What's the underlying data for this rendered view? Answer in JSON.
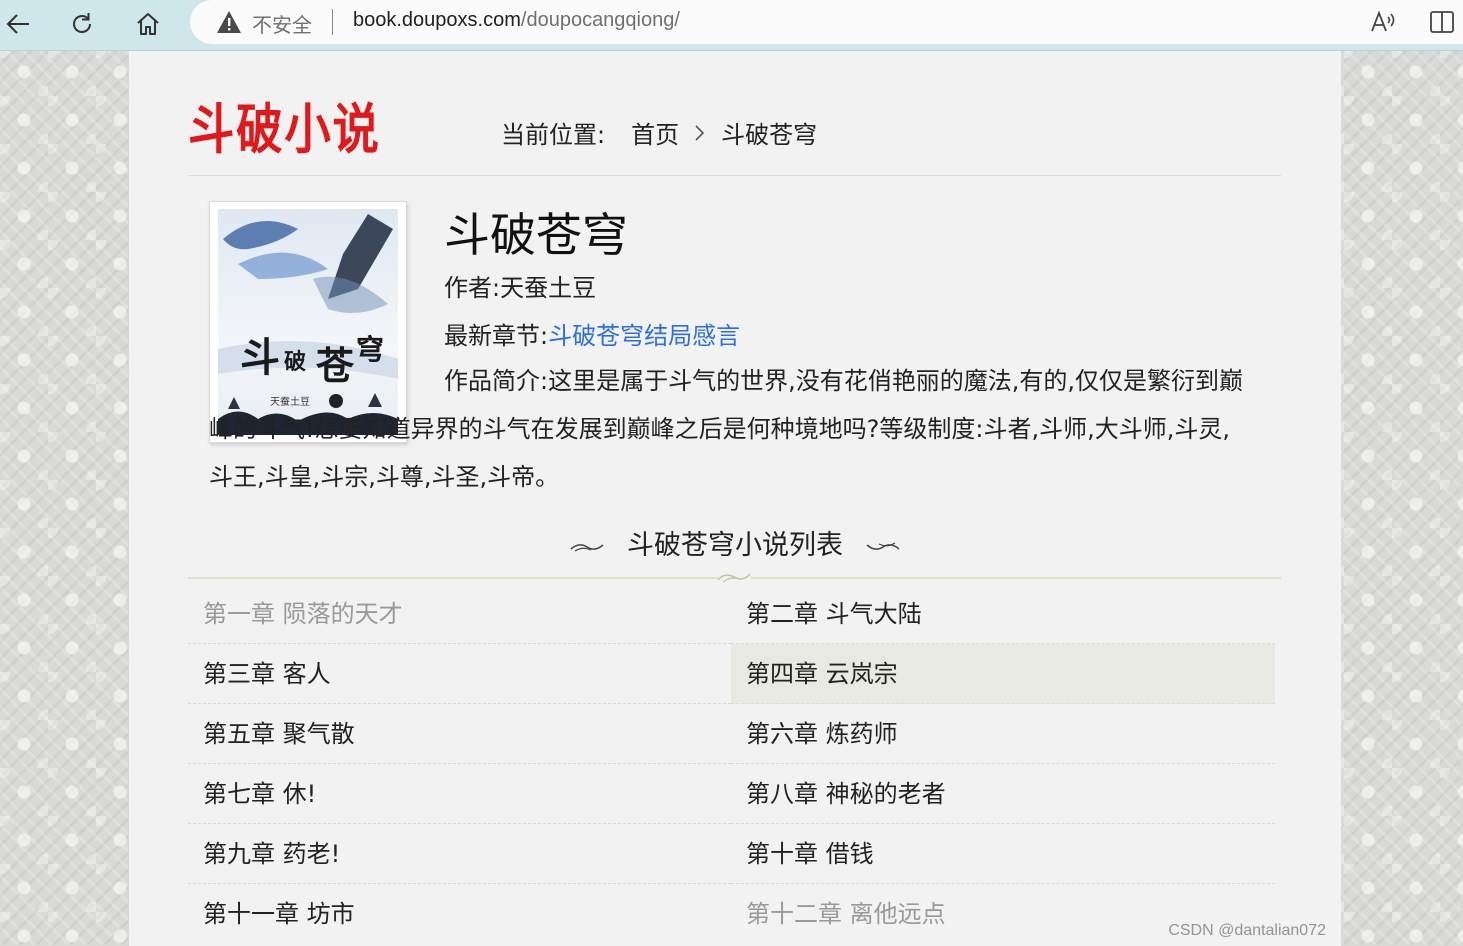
{
  "browser": {
    "security_label": "不安全",
    "url_host": "book.doupoxs.com",
    "url_path": "/doupocangqiong/"
  },
  "site": {
    "logo_text": "斗破小说",
    "logo_color": "#e0191b"
  },
  "breadcrumb": {
    "label": "当前位置:",
    "home": "首页",
    "current": "斗破苍穹"
  },
  "book": {
    "cover_icon": "book-cover-image",
    "title": "斗破苍穹",
    "author_line": "作者:天蚕土豆",
    "latest_label": "最新章节:",
    "latest_chapter": "斗破苍穹结局感言",
    "intro": "作品简介:这里是属于斗气的世界,没有花俏艳丽的魔法,有的,仅仅是繁衍到巅峰的斗气!想要知道异界的斗气在发展到巅峰之后是何种境地吗?等级制度:斗者,斗师,大斗师,斗灵,斗王,斗皇,斗宗,斗尊,斗圣,斗帝。"
  },
  "chapter_list": {
    "heading": "斗破苍穹小说列表",
    "chapters": [
      {
        "title": "第一章 陨落的天才",
        "state": "visited"
      },
      {
        "title": "第二章 斗气大陆",
        "state": "normal"
      },
      {
        "title": "第三章 客人",
        "state": "normal"
      },
      {
        "title": "第四章 云岚宗",
        "state": "hover"
      },
      {
        "title": "第五章 聚气散",
        "state": "normal"
      },
      {
        "title": "第六章 炼药师",
        "state": "normal"
      },
      {
        "title": "第七章 休!",
        "state": "normal"
      },
      {
        "title": "第八章 神秘的老者",
        "state": "normal"
      },
      {
        "title": "第九章 药老!",
        "state": "normal"
      },
      {
        "title": "第十章 借钱",
        "state": "normal"
      },
      {
        "title": "第十一章 坊市",
        "state": "normal"
      },
      {
        "title": "第十二章 离他远点",
        "state": "visited"
      }
    ]
  },
  "watermark": "CSDN @dantalian072"
}
